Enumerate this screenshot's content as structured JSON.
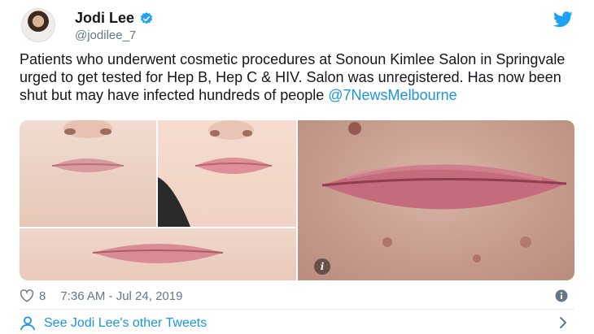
{
  "author": {
    "name": "Jodi Lee",
    "handle": "@jodilee_7",
    "verified": true
  },
  "tweet": {
    "text": "Patients who underwent cosmetic procedures at Sonoun Kimlee Salon in Springvale urged to get tested for Hep B, Hep C & HIV. Salon was unregistered. Has now been shut but may have infected hundreds of people ",
    "mention": "@7NewsMelbourne"
  },
  "media": {
    "info_badge": "i"
  },
  "meta": {
    "likes": "8",
    "timestamp": "7:36 AM - Jul 24, 2019"
  },
  "footer": {
    "other_tweets_label": "See Jodi Lee's other Tweets"
  },
  "icons": {
    "verified": "verified-badge-icon",
    "bird": "twitter-bird-icon",
    "heart": "heart-icon",
    "info": "info-icon",
    "person": "person-icon",
    "chevron": "chevron-right-icon"
  },
  "colors": {
    "link": "#1b95e0",
    "muted": "#657786",
    "text": "#14171a"
  }
}
